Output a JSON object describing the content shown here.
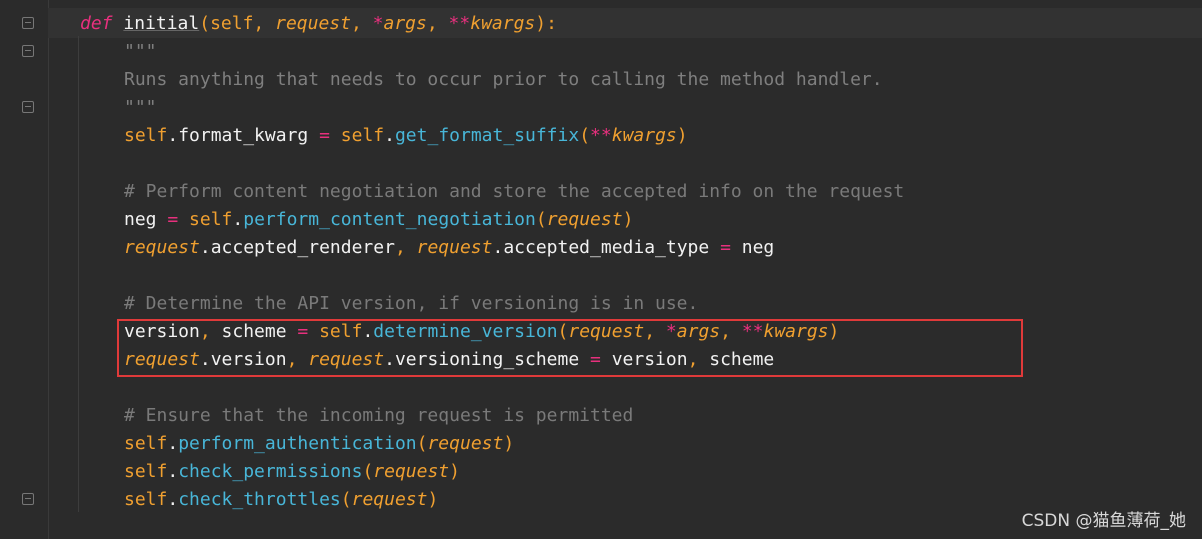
{
  "editor": {
    "lines": [
      {
        "segments": [
          [
            "kw",
            "def"
          ],
          [
            "plain",
            " "
          ],
          [
            "fn",
            "initial"
          ],
          [
            "pun",
            "("
          ],
          [
            "slf",
            "self"
          ],
          [
            "pun",
            ", "
          ],
          [
            "prm",
            "request"
          ],
          [
            "pun",
            ", "
          ],
          [
            "op",
            "*"
          ],
          [
            "prm",
            "args"
          ],
          [
            "pun",
            ", "
          ],
          [
            "op",
            "**"
          ],
          [
            "prm",
            "kwargs"
          ],
          [
            "pun",
            "):"
          ]
        ]
      },
      {
        "segments": [
          [
            "doc",
            "\"\"\""
          ]
        ]
      },
      {
        "segments": [
          [
            "doc",
            "Runs anything that needs to occur prior to calling the method handler."
          ]
        ]
      },
      {
        "segments": [
          [
            "doc",
            "\"\"\""
          ]
        ]
      },
      {
        "segments": [
          [
            "slf",
            "self"
          ],
          [
            "plain",
            ".format_kwarg "
          ],
          [
            "op",
            "="
          ],
          [
            "plain",
            " "
          ],
          [
            "slf",
            "self"
          ],
          [
            "plain",
            "."
          ],
          [
            "mth",
            "get_format_suffix"
          ],
          [
            "pun",
            "("
          ],
          [
            "op",
            "**"
          ],
          [
            "prm",
            "kwargs"
          ],
          [
            "pun",
            ")"
          ]
        ]
      },
      {
        "segments": []
      },
      {
        "segments": [
          [
            "com",
            "# Perform content negotiation and store the accepted info on the request"
          ]
        ]
      },
      {
        "segments": [
          [
            "plain",
            "neg "
          ],
          [
            "op",
            "="
          ],
          [
            "plain",
            " "
          ],
          [
            "slf",
            "self"
          ],
          [
            "plain",
            "."
          ],
          [
            "mth",
            "perform_content_negotiation"
          ],
          [
            "pun",
            "("
          ],
          [
            "prm",
            "request"
          ],
          [
            "pun",
            ")"
          ]
        ]
      },
      {
        "segments": [
          [
            "prm",
            "request"
          ],
          [
            "plain",
            ".accepted_renderer"
          ],
          [
            "pun",
            ", "
          ],
          [
            "prm",
            "request"
          ],
          [
            "plain",
            ".accepted_media_type "
          ],
          [
            "op",
            "="
          ],
          [
            "plain",
            " neg"
          ]
        ]
      },
      {
        "segments": []
      },
      {
        "segments": [
          [
            "com",
            "# Determine the API version, if versioning is in use."
          ]
        ]
      },
      {
        "segments": [
          [
            "plain",
            "version"
          ],
          [
            "pun",
            ", "
          ],
          [
            "plain",
            "scheme "
          ],
          [
            "op",
            "="
          ],
          [
            "plain",
            " "
          ],
          [
            "slf",
            "self"
          ],
          [
            "plain",
            "."
          ],
          [
            "mth",
            "determine_version"
          ],
          [
            "pun",
            "("
          ],
          [
            "prm",
            "request"
          ],
          [
            "pun",
            ", "
          ],
          [
            "op",
            "*"
          ],
          [
            "prm",
            "args"
          ],
          [
            "pun",
            ", "
          ],
          [
            "op",
            "**"
          ],
          [
            "prm",
            "kwargs"
          ],
          [
            "pun",
            ")"
          ]
        ]
      },
      {
        "segments": [
          [
            "prm",
            "request"
          ],
          [
            "plain",
            ".version"
          ],
          [
            "pun",
            ", "
          ],
          [
            "prm",
            "request"
          ],
          [
            "plain",
            ".versioning_scheme "
          ],
          [
            "op",
            "="
          ],
          [
            "plain",
            " version"
          ],
          [
            "pun",
            ", "
          ],
          [
            "plain",
            "scheme"
          ]
        ]
      },
      {
        "segments": []
      },
      {
        "segments": [
          [
            "com",
            "# Ensure that the incoming request is permitted"
          ]
        ]
      },
      {
        "segments": [
          [
            "slf",
            "self"
          ],
          [
            "plain",
            "."
          ],
          [
            "mth",
            "perform_authentication"
          ],
          [
            "pun",
            "("
          ],
          [
            "prm",
            "request"
          ],
          [
            "pun",
            ")"
          ]
        ]
      },
      {
        "segments": [
          [
            "slf",
            "self"
          ],
          [
            "plain",
            "."
          ],
          [
            "mth",
            "check_permissions"
          ],
          [
            "pun",
            "("
          ],
          [
            "prm",
            "request"
          ],
          [
            "pun",
            ")"
          ]
        ]
      },
      {
        "segments": [
          [
            "slf",
            "self"
          ],
          [
            "plain",
            "."
          ],
          [
            "mth",
            "check_throttles"
          ],
          [
            "pun",
            "("
          ],
          [
            "prm",
            "request"
          ],
          [
            "pun",
            ")"
          ]
        ]
      }
    ]
  },
  "watermark": "CSDN @猫鱼薄荷_她",
  "colors": {
    "background": "#2b2b2b",
    "keyword": "#e8307e",
    "self": "#f0a030",
    "method": "#48b6d8",
    "comment": "#7a7a7a",
    "highlight_border": "#e03a3a"
  }
}
